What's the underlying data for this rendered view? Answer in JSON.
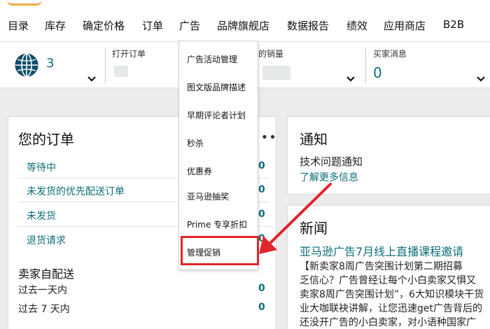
{
  "nav": {
    "items": [
      "目录",
      "库存",
      "确定价格",
      "订单",
      "广告",
      "品牌旗舰店",
      "数据报告",
      "绩效",
      "应用商店",
      "B2B"
    ]
  },
  "stats": {
    "globe_count": "3",
    "open_orders_label": "打开订单",
    "sales_label": "的销量",
    "buyer_messages_label": "买家消息",
    "buyer_messages_value": "0"
  },
  "ad_menu": {
    "items": [
      "广告活动管理",
      "图文版品牌描述",
      "早期评论者计划",
      "秒杀",
      "优惠券",
      "亚马逊抽奖",
      "Prime 专享折扣",
      "管理促销"
    ]
  },
  "orders": {
    "title": "您的订单",
    "rows": [
      {
        "label": "等待中",
        "count": "0"
      },
      {
        "label": "未发货的优先配送订单",
        "count": "0"
      },
      {
        "label": "未发货",
        "count": "0"
      },
      {
        "label": "退货请求",
        "count": "0"
      }
    ],
    "seller_section": "卖家自配送",
    "seller_rows": [
      {
        "label": "过去一天内",
        "count": "0"
      },
      {
        "label": "过去 7 天内",
        "count": "0"
      }
    ]
  },
  "notice": {
    "title": "通知",
    "item": "技术问题通知",
    "link": "了解更多信息"
  },
  "news": {
    "title": "新闻",
    "headline": "亚马逊广告7月线上直播课程邀请",
    "lines": [
      "【新卖家8周广告突围计划第二期招募",
      "乏信心？广告曾经让每个小白卖家又惧又",
      "卖家8周广告突围计划”，6大知识模块干货",
      "业大咖联袂讲解，让您迅速get广告背后的",
      "还没开广告的小白卖家，对小语种国家广"
    ]
  },
  "colors": {
    "link": "#0c6e78",
    "highlight": "#e0262b",
    "logo": "#f3a847"
  }
}
